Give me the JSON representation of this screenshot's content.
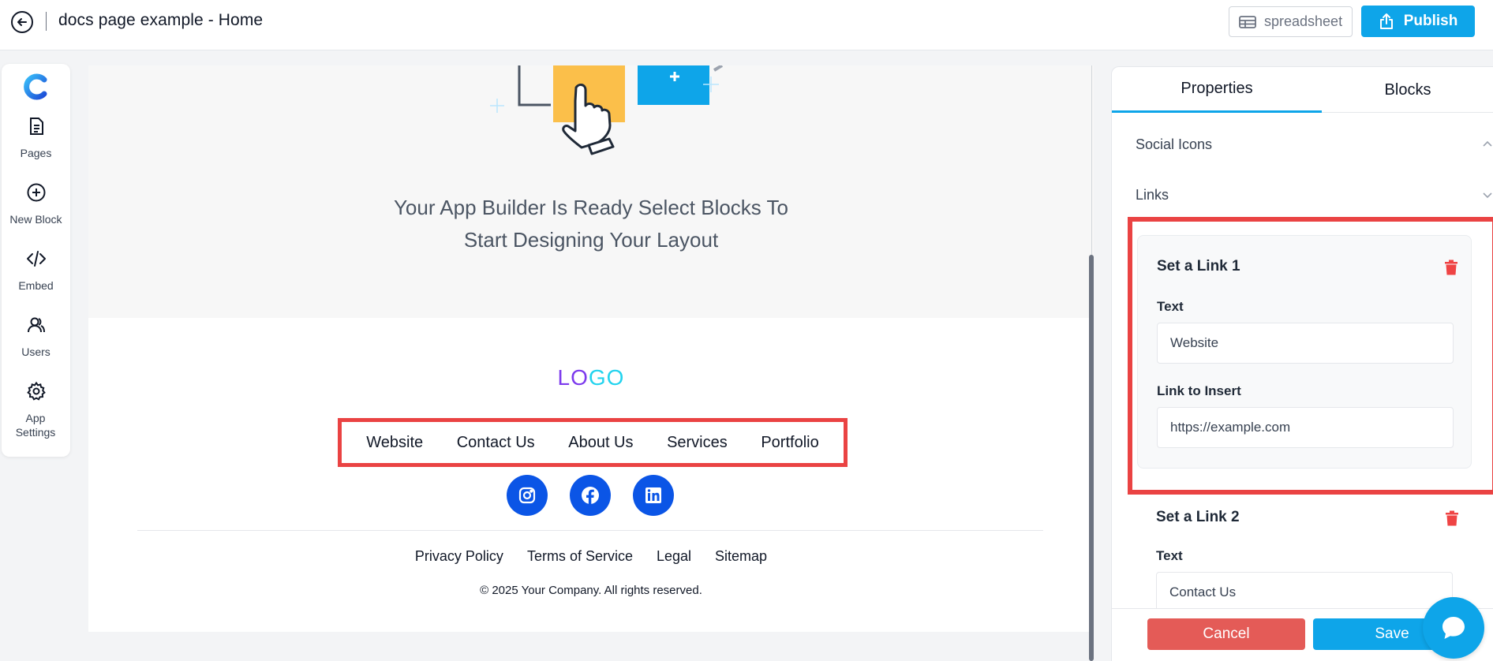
{
  "header": {
    "title": "docs page example - Home",
    "spreadsheet_label": "spreadsheet",
    "publish_label": "Publish"
  },
  "sidebar": {
    "items": [
      {
        "label": "Pages",
        "icon": "document-icon"
      },
      {
        "label": "New Block",
        "icon": "plus-circle-icon"
      },
      {
        "label": "Embed",
        "icon": "code-icon"
      },
      {
        "label": "Users",
        "icon": "users-icon"
      },
      {
        "label": "App Settings",
        "icon": "gear-icon"
      }
    ]
  },
  "canvas": {
    "hero_line1": "Your App Builder Is Ready Select Blocks To",
    "hero_line2": "Start Designing Your Layout",
    "logo_lo": "LO",
    "logo_go": "GO",
    "nav_links": [
      "Website",
      "Contact Us",
      "About Us",
      "Services",
      "Portfolio"
    ],
    "social_icons": [
      "instagram-icon",
      "facebook-icon",
      "linkedin-icon"
    ],
    "legal_links": [
      "Privacy Policy",
      "Terms of Service",
      "Legal",
      "Sitemap"
    ],
    "copyright": "© 2025 Your Company. All rights reserved."
  },
  "panel": {
    "tabs": [
      "Properties",
      "Blocks"
    ],
    "active_tab": "Properties",
    "sections": [
      "Social Icons",
      "Links"
    ],
    "links": [
      {
        "title": "Set a Link 1",
        "text_label": "Text",
        "text_value": "Website",
        "url_label": "Link to Insert",
        "url_value": "https://example.com"
      },
      {
        "title": "Set a Link 2",
        "text_label": "Text",
        "text_value": "Contact Us"
      }
    ],
    "cancel_label": "Cancel",
    "save_label": "Save"
  },
  "colors": {
    "accent": "#0ea5e9",
    "danger": "#e45b57",
    "highlight": "#ea4343",
    "social": "#0b55e6",
    "logo_lo": "#7c3aed",
    "logo_go": "#22d3ee"
  }
}
